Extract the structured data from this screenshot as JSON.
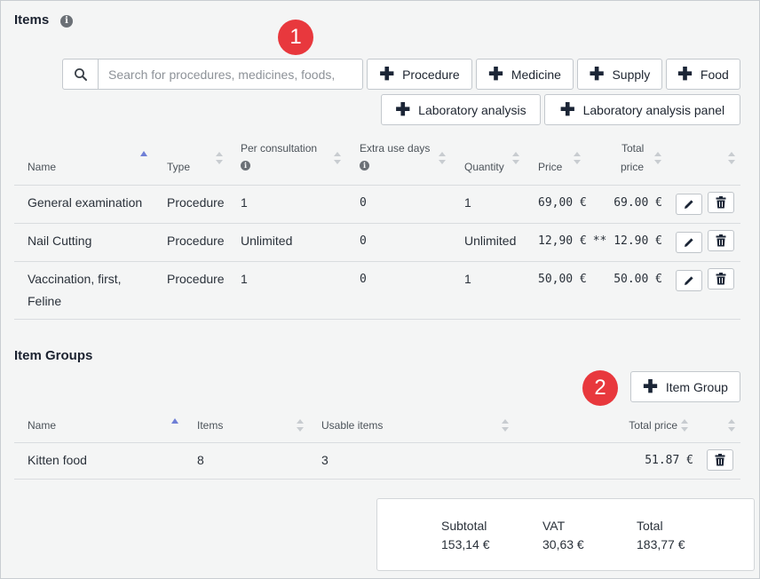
{
  "items_section": {
    "title": "Items",
    "info_icon": "info-icon",
    "marker": "1",
    "search": {
      "placeholder": "Search for procedures, medicines, foods,",
      "value": ""
    },
    "buttons": {
      "procedure": "Procedure",
      "medicine": "Medicine",
      "supply": "Supply",
      "food": "Food",
      "lab_analysis": "Laboratory analysis",
      "lab_panel": "Laboratory analysis panel"
    },
    "columns": {
      "name": "Name",
      "type": "Type",
      "per_consultation": "Per consultation",
      "extra_use_days": "Extra use days",
      "quantity": "Quantity",
      "price": "Price",
      "total_price_1": "Total",
      "total_price_2": "price"
    },
    "rows": [
      {
        "name_1": "General examination",
        "name_2": "",
        "type": "Procedure",
        "per_consultation": "1",
        "extra_use_days": "0",
        "quantity": "1",
        "price": "69,00 €",
        "total": "69.00 €"
      },
      {
        "name_1": "Nail Cutting",
        "name_2": "",
        "type": "Procedure",
        "per_consultation": "Unlimited",
        "extra_use_days": "0",
        "quantity": "Unlimited",
        "price": "12,90 €",
        "total": "** 12.90 €"
      },
      {
        "name_1": "Vaccination, first,",
        "name_2": "Feline",
        "type": "Procedure",
        "per_consultation": "1",
        "extra_use_days": "0",
        "quantity": "1",
        "price": "50,00 €",
        "total": "50.00 €"
      }
    ]
  },
  "groups_section": {
    "title": "Item Groups",
    "marker": "2",
    "add_button": "Item Group",
    "columns": {
      "name": "Name",
      "items": "Items",
      "usable_items": "Usable items",
      "total_price": "Total price"
    },
    "rows": [
      {
        "name": "Kitten food",
        "items": "8",
        "usable_items": "3",
        "total": "51.87 €"
      }
    ]
  },
  "summary": {
    "subtotal_label": "Subtotal",
    "subtotal_value": "153,14 €",
    "vat_label": "VAT",
    "vat_value": "30,63 €",
    "total_label": "Total",
    "total_value": "183,77 €"
  },
  "colors": {
    "marker": "#e8383d",
    "sort_active": "#6f7fd6",
    "icon_dark": "#1b2536"
  }
}
